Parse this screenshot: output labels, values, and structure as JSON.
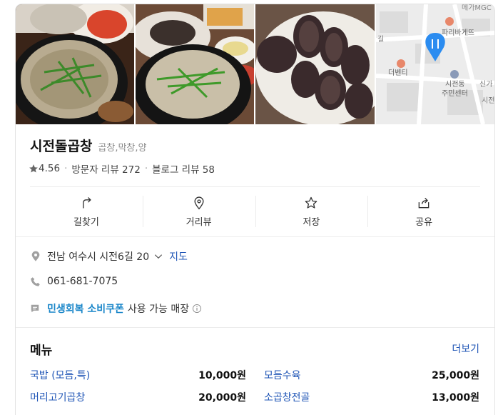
{
  "place": {
    "name": "시전돌곱창",
    "category": "곱창,막창,양",
    "rating": "4.56",
    "visitor_reviews": "방문자 리뷰 272",
    "blog_reviews": "블로그 리뷰 58"
  },
  "map": {
    "labels": [
      "메가MGC",
      "파리바게뜨",
      "더벤티",
      "시전동",
      "주민센터",
      "신가",
      "시전",
      "길"
    ]
  },
  "actions": [
    {
      "label": "길찾기",
      "icon": "directions-icon"
    },
    {
      "label": "거리뷰",
      "icon": "location-pin-icon"
    },
    {
      "label": "저장",
      "icon": "star-icon"
    },
    {
      "label": "공유",
      "icon": "share-icon"
    }
  ],
  "info": {
    "address": "전남 여수시 시전6길 20",
    "map_link": "지도",
    "phone": "061-681-7075",
    "coupon_name": "민생회복 소비쿠폰",
    "coupon_text": "사용 가능 매장"
  },
  "menu": {
    "title": "메뉴",
    "more": "더보기",
    "items": [
      {
        "name": "국밥 (모듬,특)",
        "price": "10,000원"
      },
      {
        "name": "모듬수육",
        "price": "25,000원"
      },
      {
        "name": "머리고기곱창",
        "price": "20,000원"
      },
      {
        "name": "소곱창전골",
        "price": "13,000원"
      }
    ]
  },
  "colors": {
    "link": "#1f55b6",
    "coupon": "#1a86c9",
    "map_marker": "#2b8cf0"
  }
}
